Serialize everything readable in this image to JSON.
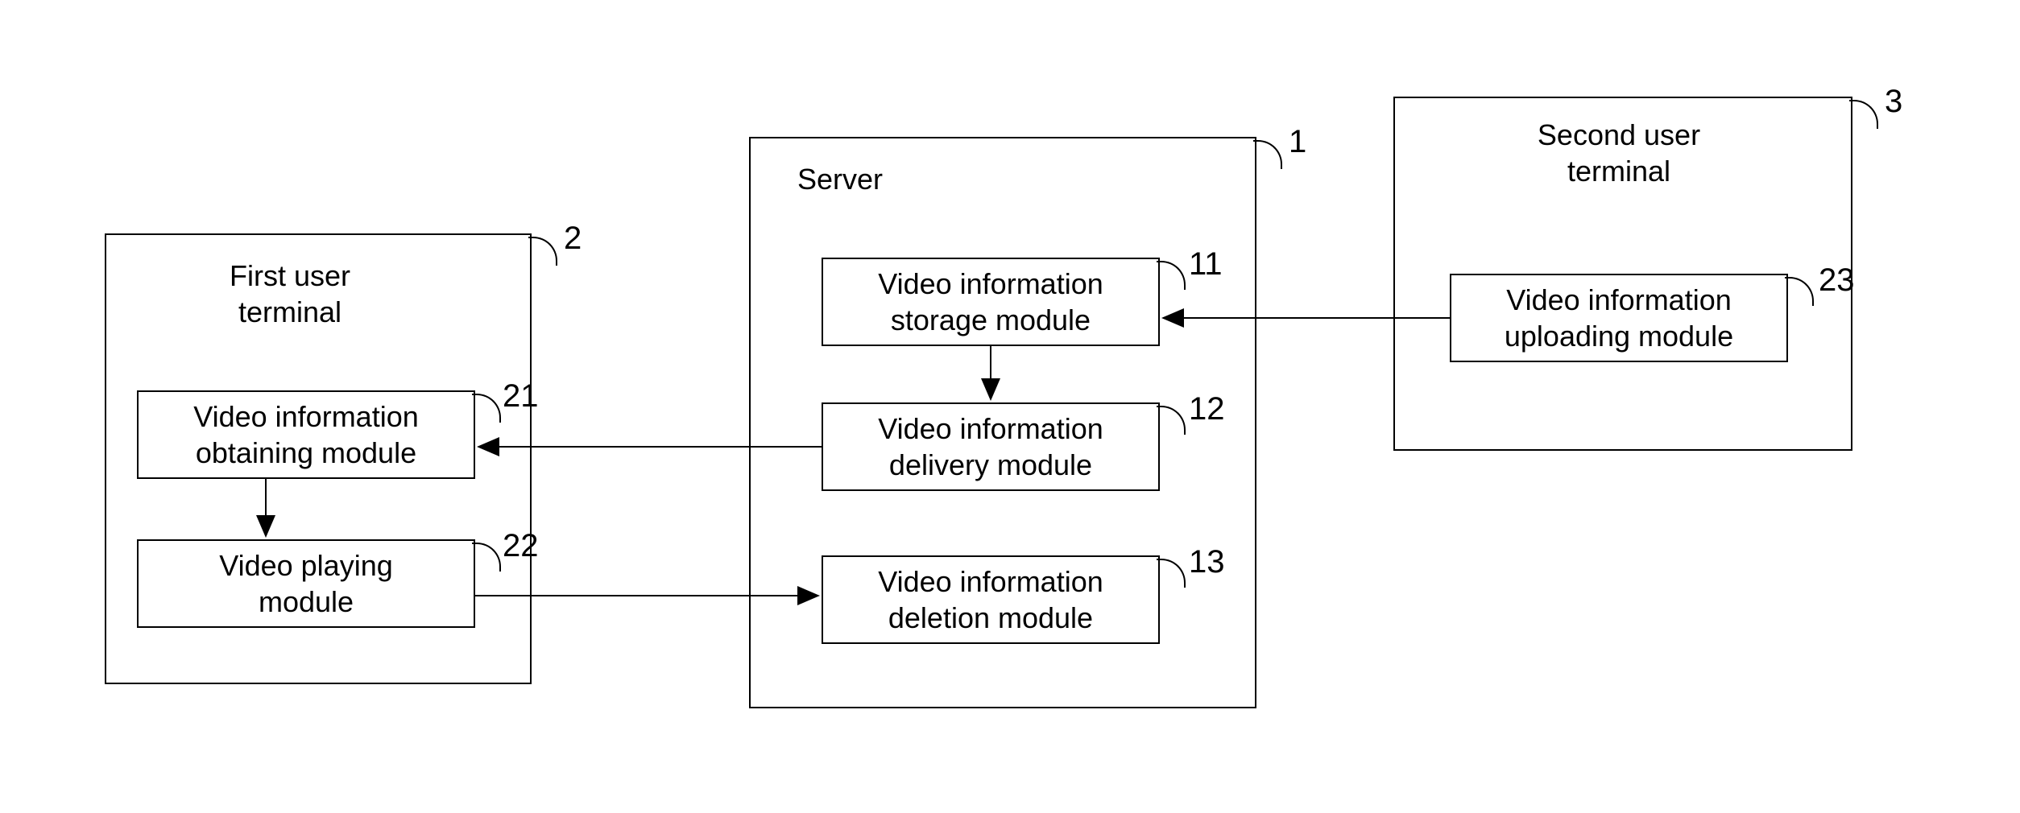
{
  "containers": {
    "first_user_terminal": {
      "title": "First user\nterminal",
      "ref": "2"
    },
    "server": {
      "title": "Server",
      "ref": "1"
    },
    "second_user_terminal": {
      "title": "Second user\nterminal",
      "ref": "3"
    }
  },
  "modules": {
    "m21": {
      "label": "Video information\nobtaining module",
      "ref": "21"
    },
    "m22": {
      "label": "Video playing\nmodule",
      "ref": "22"
    },
    "m11": {
      "label": "Video information\nstorage module",
      "ref": "11"
    },
    "m12": {
      "label": "Video information\ndelivery module",
      "ref": "12"
    },
    "m13": {
      "label": "Video information\ndeletion module",
      "ref": "13"
    },
    "m23": {
      "label": "Video information\nuploading module",
      "ref": "23"
    }
  }
}
